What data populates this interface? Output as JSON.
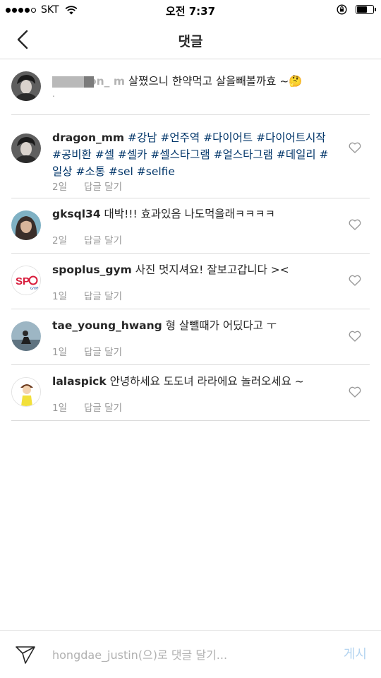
{
  "status_bar": {
    "carrier": "SKT",
    "time": "오전 7:37"
  },
  "nav": {
    "title": "댓글"
  },
  "caption": {
    "username_visible": "on_ m",
    "text": "살쪘으니 한약먹고 살을빼볼까효 ~🤔",
    "extra": "."
  },
  "comments": [
    {
      "username": "dragon_mm",
      "tags": [
        "#강남",
        "#언주역",
        "#다이어트",
        "#다이어트시작",
        "#공비환",
        "#셀",
        "#셀카",
        "#셀스타그램",
        "#얼스타그램",
        "#데일리",
        "#일상",
        "#소통",
        "#sel",
        "#selfie"
      ],
      "time": "2일",
      "reply": "답글 달기"
    },
    {
      "username": "gksql34",
      "text": "대박!!! 효과있음 나도먹을래ㅋㅋㅋㅋ",
      "time": "2일",
      "reply": "답글 달기"
    },
    {
      "username": "spoplus_gym",
      "text": "사진 멋지셔요! 잘보고갑니다 ><",
      "time": "1일",
      "reply": "답글 달기"
    },
    {
      "username": "tae_young_hwang",
      "text": "형 살뺄때가 어딨다고 ㅜ",
      "time": "1일",
      "reply": "답글 달기"
    },
    {
      "username": "lalaspick",
      "text": "안녕하세요 도도녀 라라에요 놀러오세요 ~",
      "time": "1일",
      "reply": "답글 달기"
    }
  ],
  "input_bar": {
    "placeholder": "hongdae_justin(으)로 댓글 달기...",
    "post_label": "게시"
  },
  "colors": {
    "hashtag": "#003569",
    "meta": "#999999",
    "post_button": "#b4d4f0",
    "divider": "#dbdbdb"
  }
}
